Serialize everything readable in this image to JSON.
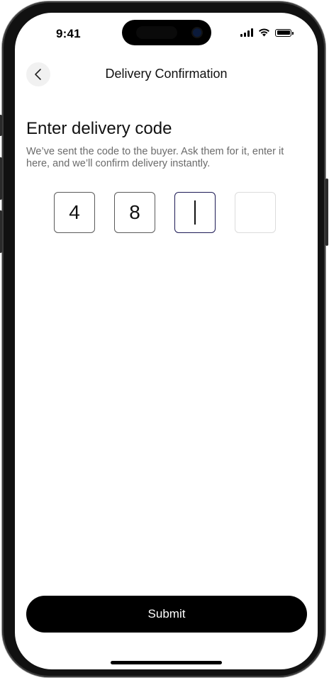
{
  "status_bar": {
    "time": "9:41",
    "icons": [
      "cellular-signal-icon",
      "wifi-icon",
      "battery-icon"
    ]
  },
  "nav": {
    "back_icon": "chevron-left-icon",
    "title": "Delivery Confirmation"
  },
  "content": {
    "heading": "Enter delivery code",
    "description": "We’ve sent the code to the buyer. Ask them for it, enter it here, and we’ll confirm delivery instantly.",
    "code_digits": [
      "4",
      "8",
      "",
      ""
    ],
    "active_index": 2
  },
  "actions": {
    "submit_label": "Submit"
  },
  "colors": {
    "primary": "#000000",
    "active_border": "#1d1a55",
    "muted_text": "#6b6b6b"
  }
}
